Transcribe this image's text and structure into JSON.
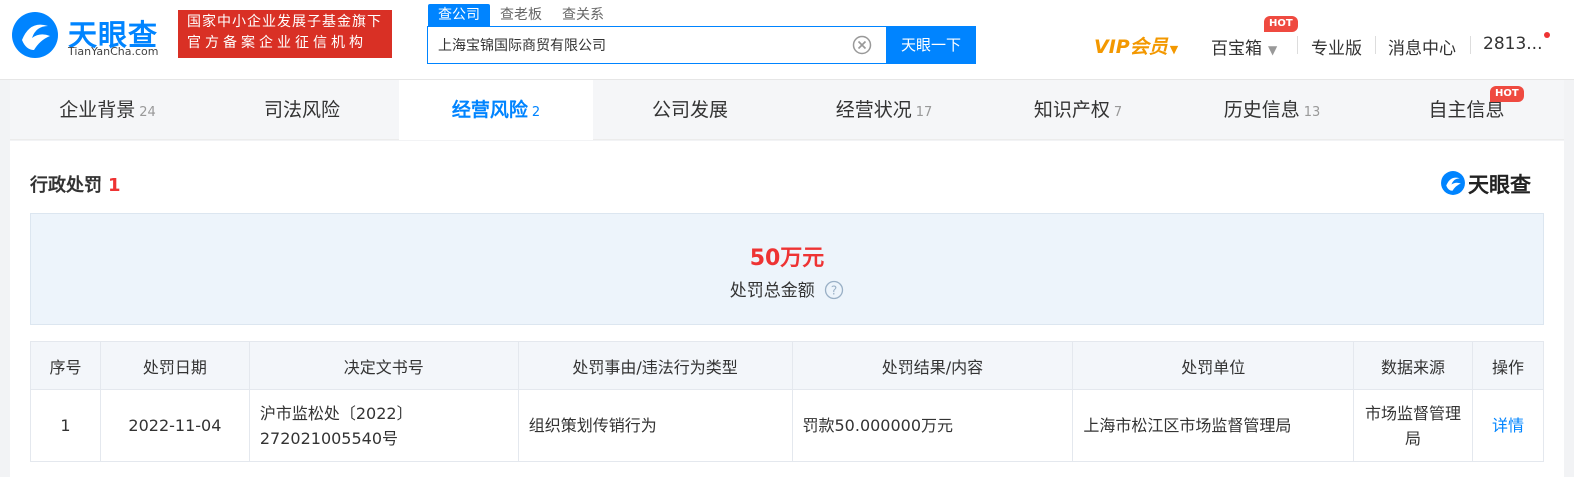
{
  "header": {
    "logo_cn": "天眼查",
    "logo_en": "TianYanCha.com",
    "badge_line1": "国家中小企业发展子基金旗下",
    "badge_line2": "官方备案企业征信机构",
    "search_tabs": [
      "查公司",
      "查老板",
      "查关系"
    ],
    "search_value": "上海宝锦国际商贸有限公司",
    "search_button": "天眼一下",
    "vip_label": "VIP会员",
    "nav_baobaoxiang": "百宝箱",
    "hot_label": "HOT",
    "nav_pro": "专业版",
    "nav_messages": "消息中心",
    "nav_user": "2813..."
  },
  "category_tabs": [
    {
      "label": "企业背景",
      "count": "24"
    },
    {
      "label": "司法风险",
      "count": ""
    },
    {
      "label": "经营风险",
      "count": "2"
    },
    {
      "label": "公司发展",
      "count": ""
    },
    {
      "label": "经营状况",
      "count": "17"
    },
    {
      "label": "知识产权",
      "count": "7"
    },
    {
      "label": "历史信息",
      "count": "13"
    },
    {
      "label": "自主信息",
      "count": ""
    }
  ],
  "section": {
    "title": "行政处罚",
    "count": "1",
    "brand": "天眼查"
  },
  "summary": {
    "amount": "50万元",
    "label": "处罚总金额"
  },
  "table": {
    "headers": [
      "序号",
      "处罚日期",
      "决定文书号",
      "处罚事由/违法行为类型",
      "处罚结果/内容",
      "处罚单位",
      "数据来源",
      "操作"
    ],
    "rows": [
      {
        "index": "1",
        "date": "2022-11-04",
        "doc_no": "沪市监松处〔2022〕272021005540号",
        "reason": "组织策划传销行为",
        "result": "罚款50.000000万元",
        "unit": "上海市松江区市场监督管理局",
        "source": "市场监督管理局",
        "action": "详情"
      }
    ]
  },
  "colors": {
    "accent": "#0084ff",
    "danger": "#e33333",
    "vip": "#f39800"
  }
}
